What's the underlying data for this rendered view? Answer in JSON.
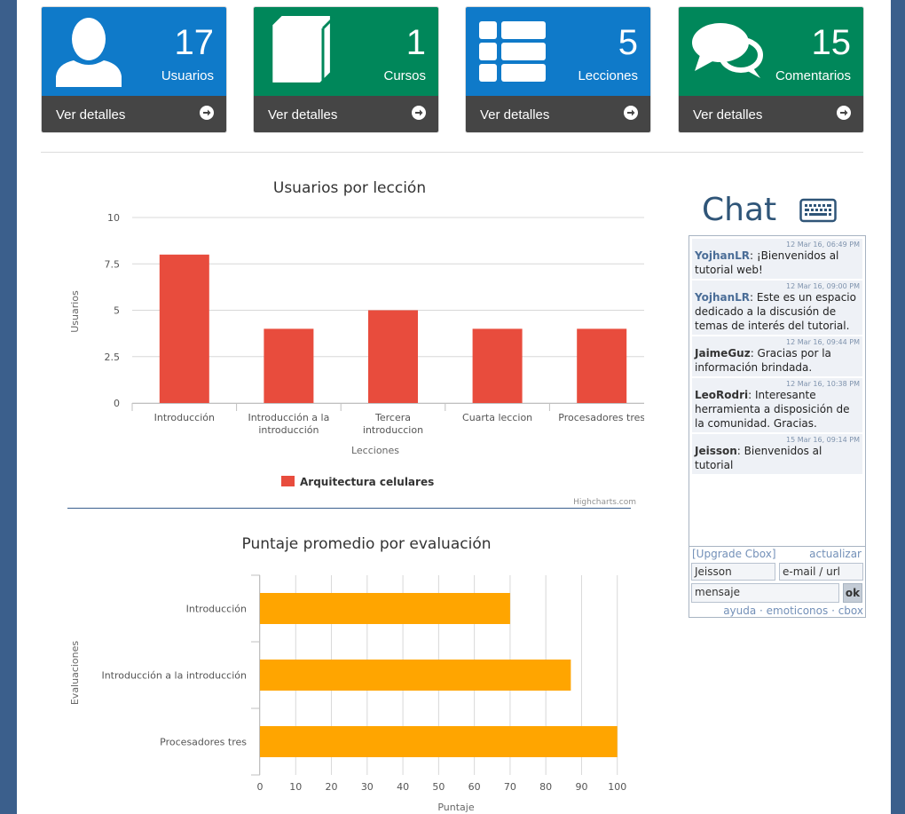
{
  "colors": {
    "blue": "#0f7ac9",
    "green": "#00875a",
    "dark": "#454545",
    "bar_red": "#e84c3d",
    "bar_orange": "#ffa500",
    "page_bg": "#3b5f8c"
  },
  "cards": [
    {
      "count": "17",
      "label": "Usuarios",
      "more": "Ver detalles",
      "icon": "user-icon"
    },
    {
      "count": "1",
      "label": "Cursos",
      "more": "Ver detalles",
      "icon": "book-icon"
    },
    {
      "count": "5",
      "label": "Lecciones",
      "more": "Ver detalles",
      "icon": "list-icon"
    },
    {
      "count": "15",
      "label": "Comentarios",
      "more": "Ver detalles",
      "icon": "comments-icon"
    }
  ],
  "chart_data": [
    {
      "type": "bar",
      "title": "Usuarios por lección",
      "categories": [
        "Introducción",
        "Introducción a la introducción",
        "Tercera introduccion",
        "Cuarta leccion",
        "Procesadores tres"
      ],
      "category_lines": [
        [
          "Introducción"
        ],
        [
          "Introducción a la",
          "introducción"
        ],
        [
          "Tercera",
          "introduccion"
        ],
        [
          "Cuarta leccion"
        ],
        [
          "Procesadores tres"
        ]
      ],
      "series": [
        {
          "name": "Arquitectura celulares",
          "values": [
            8,
            4,
            5,
            4,
            4
          ]
        }
      ],
      "xlabel": "Lecciones",
      "ylabel": "Usuarios",
      "ylim": [
        0,
        10
      ],
      "yticks": [
        "0",
        "2.5",
        "5",
        "7.5",
        "10"
      ],
      "ytick_values": [
        0,
        2.5,
        5,
        7.5,
        10
      ],
      "legend": "bottom",
      "credits": "Highcharts.com"
    },
    {
      "type": "bar",
      "orientation": "horizontal",
      "title": "Puntaje promedio por evaluación",
      "categories": [
        "Introducción",
        "Introducción a la introducción",
        "Procesadores tres"
      ],
      "values": [
        70,
        87,
        100
      ],
      "xlabel": "Puntaje",
      "ylabel": "Evaluaciones",
      "xlim": [
        0,
        110
      ],
      "xticks": [
        "0",
        "10",
        "20",
        "30",
        "40",
        "50",
        "60",
        "70",
        "80",
        "90",
        "100",
        "1…"
      ],
      "xtick_values": [
        0,
        10,
        20,
        30,
        40,
        50,
        60,
        70,
        80,
        90,
        100,
        110
      ]
    }
  ],
  "chat": {
    "title": "Chat",
    "icon": "keyboard-icon",
    "messages": [
      {
        "time": "12 Mar 16, 06:49 PM",
        "user": "YojhanLR",
        "text": "¡Bienvenidos al tutorial web!",
        "linked": true
      },
      {
        "time": "12 Mar 16, 09:00 PM",
        "user": "YojhanLR",
        "text": "Este es un espacio dedicado a la discusión de temas de interés del tutorial.",
        "linked": true
      },
      {
        "time": "12 Mar 16, 09:44 PM",
        "user": "JaimeGuz",
        "text": "Gracias por la información brindada.",
        "linked": false
      },
      {
        "time": "12 Mar 16, 10:38 PM",
        "user": "LeoRodri",
        "text": "Interesante herramienta a disposición de la comunidad. Gracias.",
        "linked": false
      },
      {
        "time": "15 Mar 16, 09:14 PM",
        "user": "Jeisson",
        "text": "Bienvenidos al tutorial",
        "linked": false
      }
    ],
    "upgrade": "[Upgrade Cbox]",
    "refresh": "actualizar",
    "name_value": "Jeisson",
    "url_value": "e-mail / url",
    "message_value": "mensaje",
    "ok": "ok",
    "footer": "ayuda · emoticonos · cbox"
  }
}
